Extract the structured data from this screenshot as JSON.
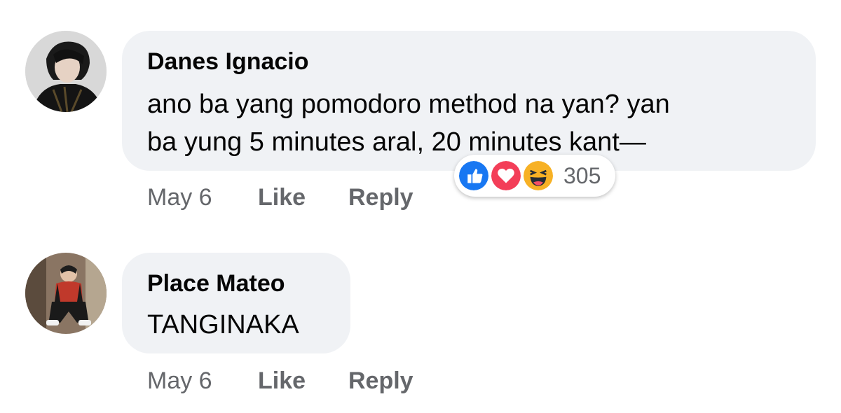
{
  "comments": [
    {
      "author": "Danes Ignacio",
      "text_lines": [
        "ano ba yang pomodoro method na yan? yan",
        "ba yung 5 minutes aral, 20 minutes kant—"
      ],
      "time": "May 6",
      "like_label": "Like",
      "reply_label": "Reply",
      "reactions": {
        "icons": [
          "like-icon",
          "love-icon",
          "haha-icon"
        ],
        "count": "305"
      }
    },
    {
      "author": "Place Mateo",
      "text_lines": [
        "TANGINAKA"
      ],
      "time": "May 6",
      "like_label": "Like",
      "reply_label": "Reply"
    }
  ],
  "colors": {
    "bubble_bg": "#f0f2f5",
    "action_text": "#65676b",
    "like_blue": "#1877f2",
    "love_red": "#f33e58",
    "haha_yellow": "#f7b125"
  }
}
